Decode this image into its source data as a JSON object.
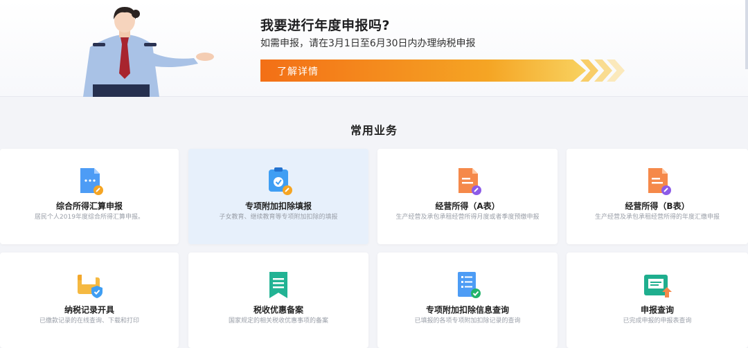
{
  "banner": {
    "title": "我要进行年度申报吗?",
    "subtitle": "如需申报，请在3月1日至6月30日内办理纳税申报",
    "button_label": "了解详情"
  },
  "section": {
    "title": "常用业务"
  },
  "services": [
    {
      "title": "综合所得汇算申报",
      "desc": "居民个人2019年度综合所得汇算申报。",
      "icon": "document-blue-icon"
    },
    {
      "title": "专项附加扣除填报",
      "desc": "子女教育、继续教育等专项附加扣除的填报",
      "icon": "clipboard-check-icon"
    },
    {
      "title": "经营所得（A表）",
      "desc": "生产经营及承包承租经营所得月度或者季度预缴申报",
      "icon": "document-orange-pen-icon"
    },
    {
      "title": "经营所得（B表）",
      "desc": "生产经营及承包承租经营所得的年度汇缴申报",
      "icon": "document-orange-pen-icon"
    },
    {
      "title": "纳税记录开具",
      "desc": "已缴款记录的在线查询、下载和打印",
      "icon": "folder-shield-icon"
    },
    {
      "title": "税收优惠备案",
      "desc": "国家规定的相关税收优惠事项的备案",
      "icon": "bookmark-list-icon"
    },
    {
      "title": "专项附加扣除信息查询",
      "desc": "已填报的各项专项附加扣除记录的查询",
      "icon": "checklist-query-icon"
    },
    {
      "title": "申报查询",
      "desc": "已完成申报的申报表查询",
      "icon": "folder-upload-icon"
    }
  ]
}
